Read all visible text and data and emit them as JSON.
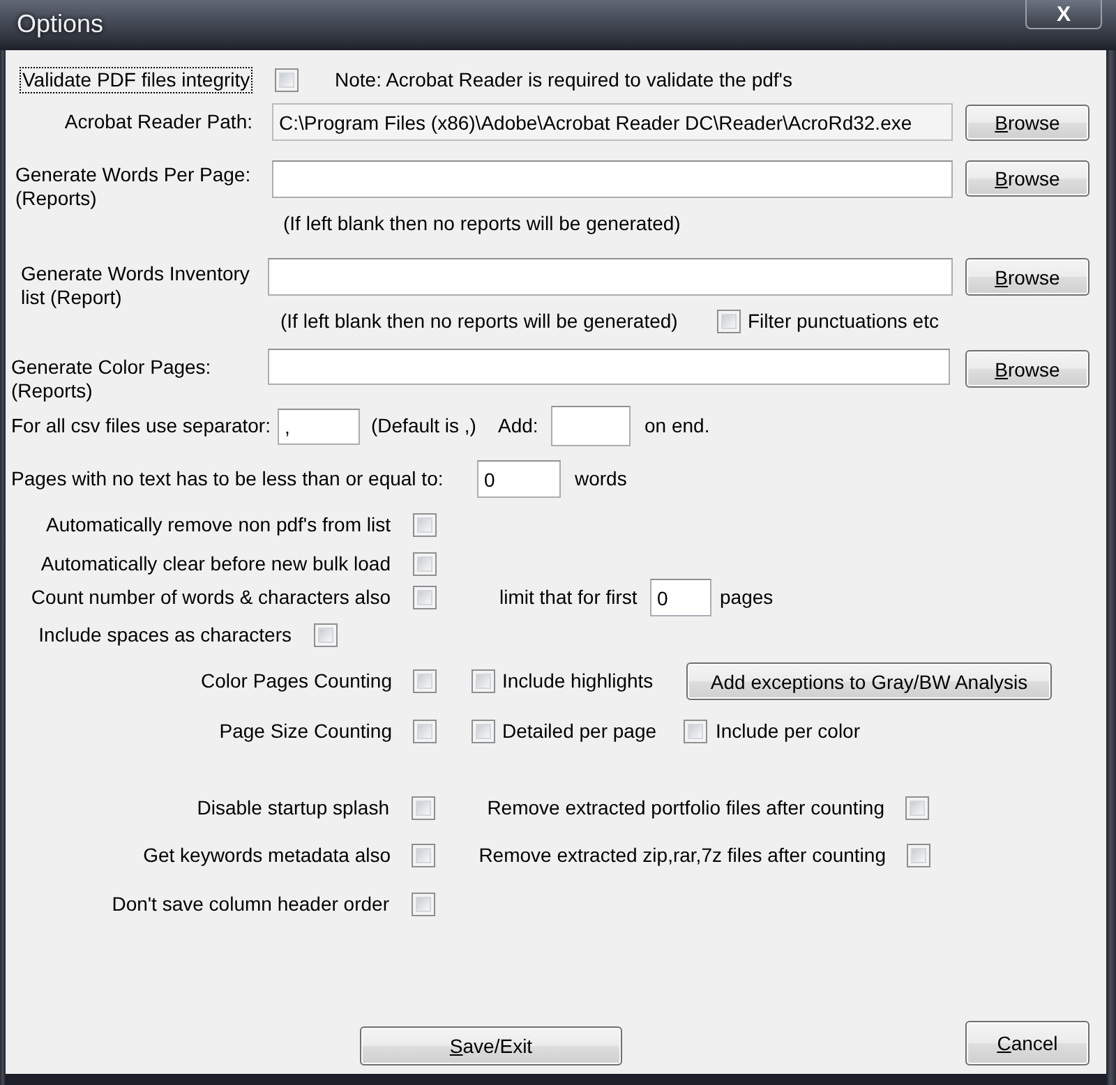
{
  "window": {
    "title": "Options",
    "close_label": "X"
  },
  "validate": {
    "label": "Validate PDF files integrity",
    "checked": false,
    "focused": true,
    "note": "Note: Acrobat Reader is required to validate the pdf's"
  },
  "file_fields": [
    {
      "label": "Acrobat Reader Path:",
      "value": "C:\\Program Files (x86)\\Adobe\\Acrobat Reader DC\\Reader\\AcroRd32.exe",
      "readonly": true,
      "button": {
        "label": "Browse",
        "mnemonic": true
      }
    },
    {
      "label": "Generate Words Per Page:\n(Reports)",
      "readonly": false,
      "button": {
        "label": "Browse",
        "mnemonic": true
      },
      "hint": "(If left blank then no reports will be generated)"
    },
    {
      "label": "Generate Words Inventory\nlist (Report)",
      "readonly": false,
      "button": {
        "label": "Browse",
        "mnemonic": true
      },
      "hint": "(If left blank then no reports will be generated)",
      "option": {
        "label": "Filter punctuations etc",
        "checked": false
      }
    },
    {
      "label": "Generate Color Pages:\n(Reports)",
      "readonly": false,
      "button": {
        "label": "Browse",
        "mnemonic": true
      }
    }
  ],
  "separator": {
    "label": "For all csv files use separator:",
    "value": ",",
    "default_note": "(Default is ,)",
    "add_label": "Add:",
    "suffix": "on end."
  },
  "empty_pages": {
    "label": "Pages with no text has to be less than or equal to:",
    "value": "0",
    "unit": "words"
  },
  "general_options": [
    {
      "label": "Automatically remove non pdf's from list",
      "checked": false
    },
    {
      "label": "Automatically clear before new bulk load",
      "checked": false
    },
    {
      "label": "Count number of words & characters also",
      "checked": false,
      "limit": {
        "label": "limit that for first",
        "value": "0",
        "unit": "pages"
      }
    },
    {
      "label": "Include spaces as characters",
      "checked": false
    }
  ],
  "counting_options": [
    {
      "label": "Color Pages Counting",
      "checked": false,
      "suboptions": [
        {
          "label": "Include highlights",
          "checked": false
        }
      ],
      "button": {
        "label": "Add exceptions to Gray/BW Analysis",
        "mnemonic": false
      }
    },
    {
      "label": "Page Size Counting",
      "checked": false,
      "suboptions": [
        {
          "label": "Detailed per page",
          "checked": false
        },
        {
          "label": "Include per color",
          "checked": false
        }
      ]
    }
  ],
  "misc_options": [
    {
      "left": {
        "label": "Disable startup splash",
        "checked": false
      },
      "right": {
        "label": "Remove extracted portfolio files after counting",
        "checked": false
      }
    },
    {
      "left": {
        "label": "Get keywords metadata also",
        "checked": false
      },
      "right": {
        "label": "Remove extracted zip,rar,7z files after counting",
        "checked": false
      }
    },
    {
      "left": {
        "label": "Don't save column header order",
        "checked": false
      }
    }
  ],
  "buttons": [
    {
      "label": "Save/Exit",
      "mnemonic": true
    },
    {
      "label": "Cancel",
      "mnemonic": true
    }
  ]
}
